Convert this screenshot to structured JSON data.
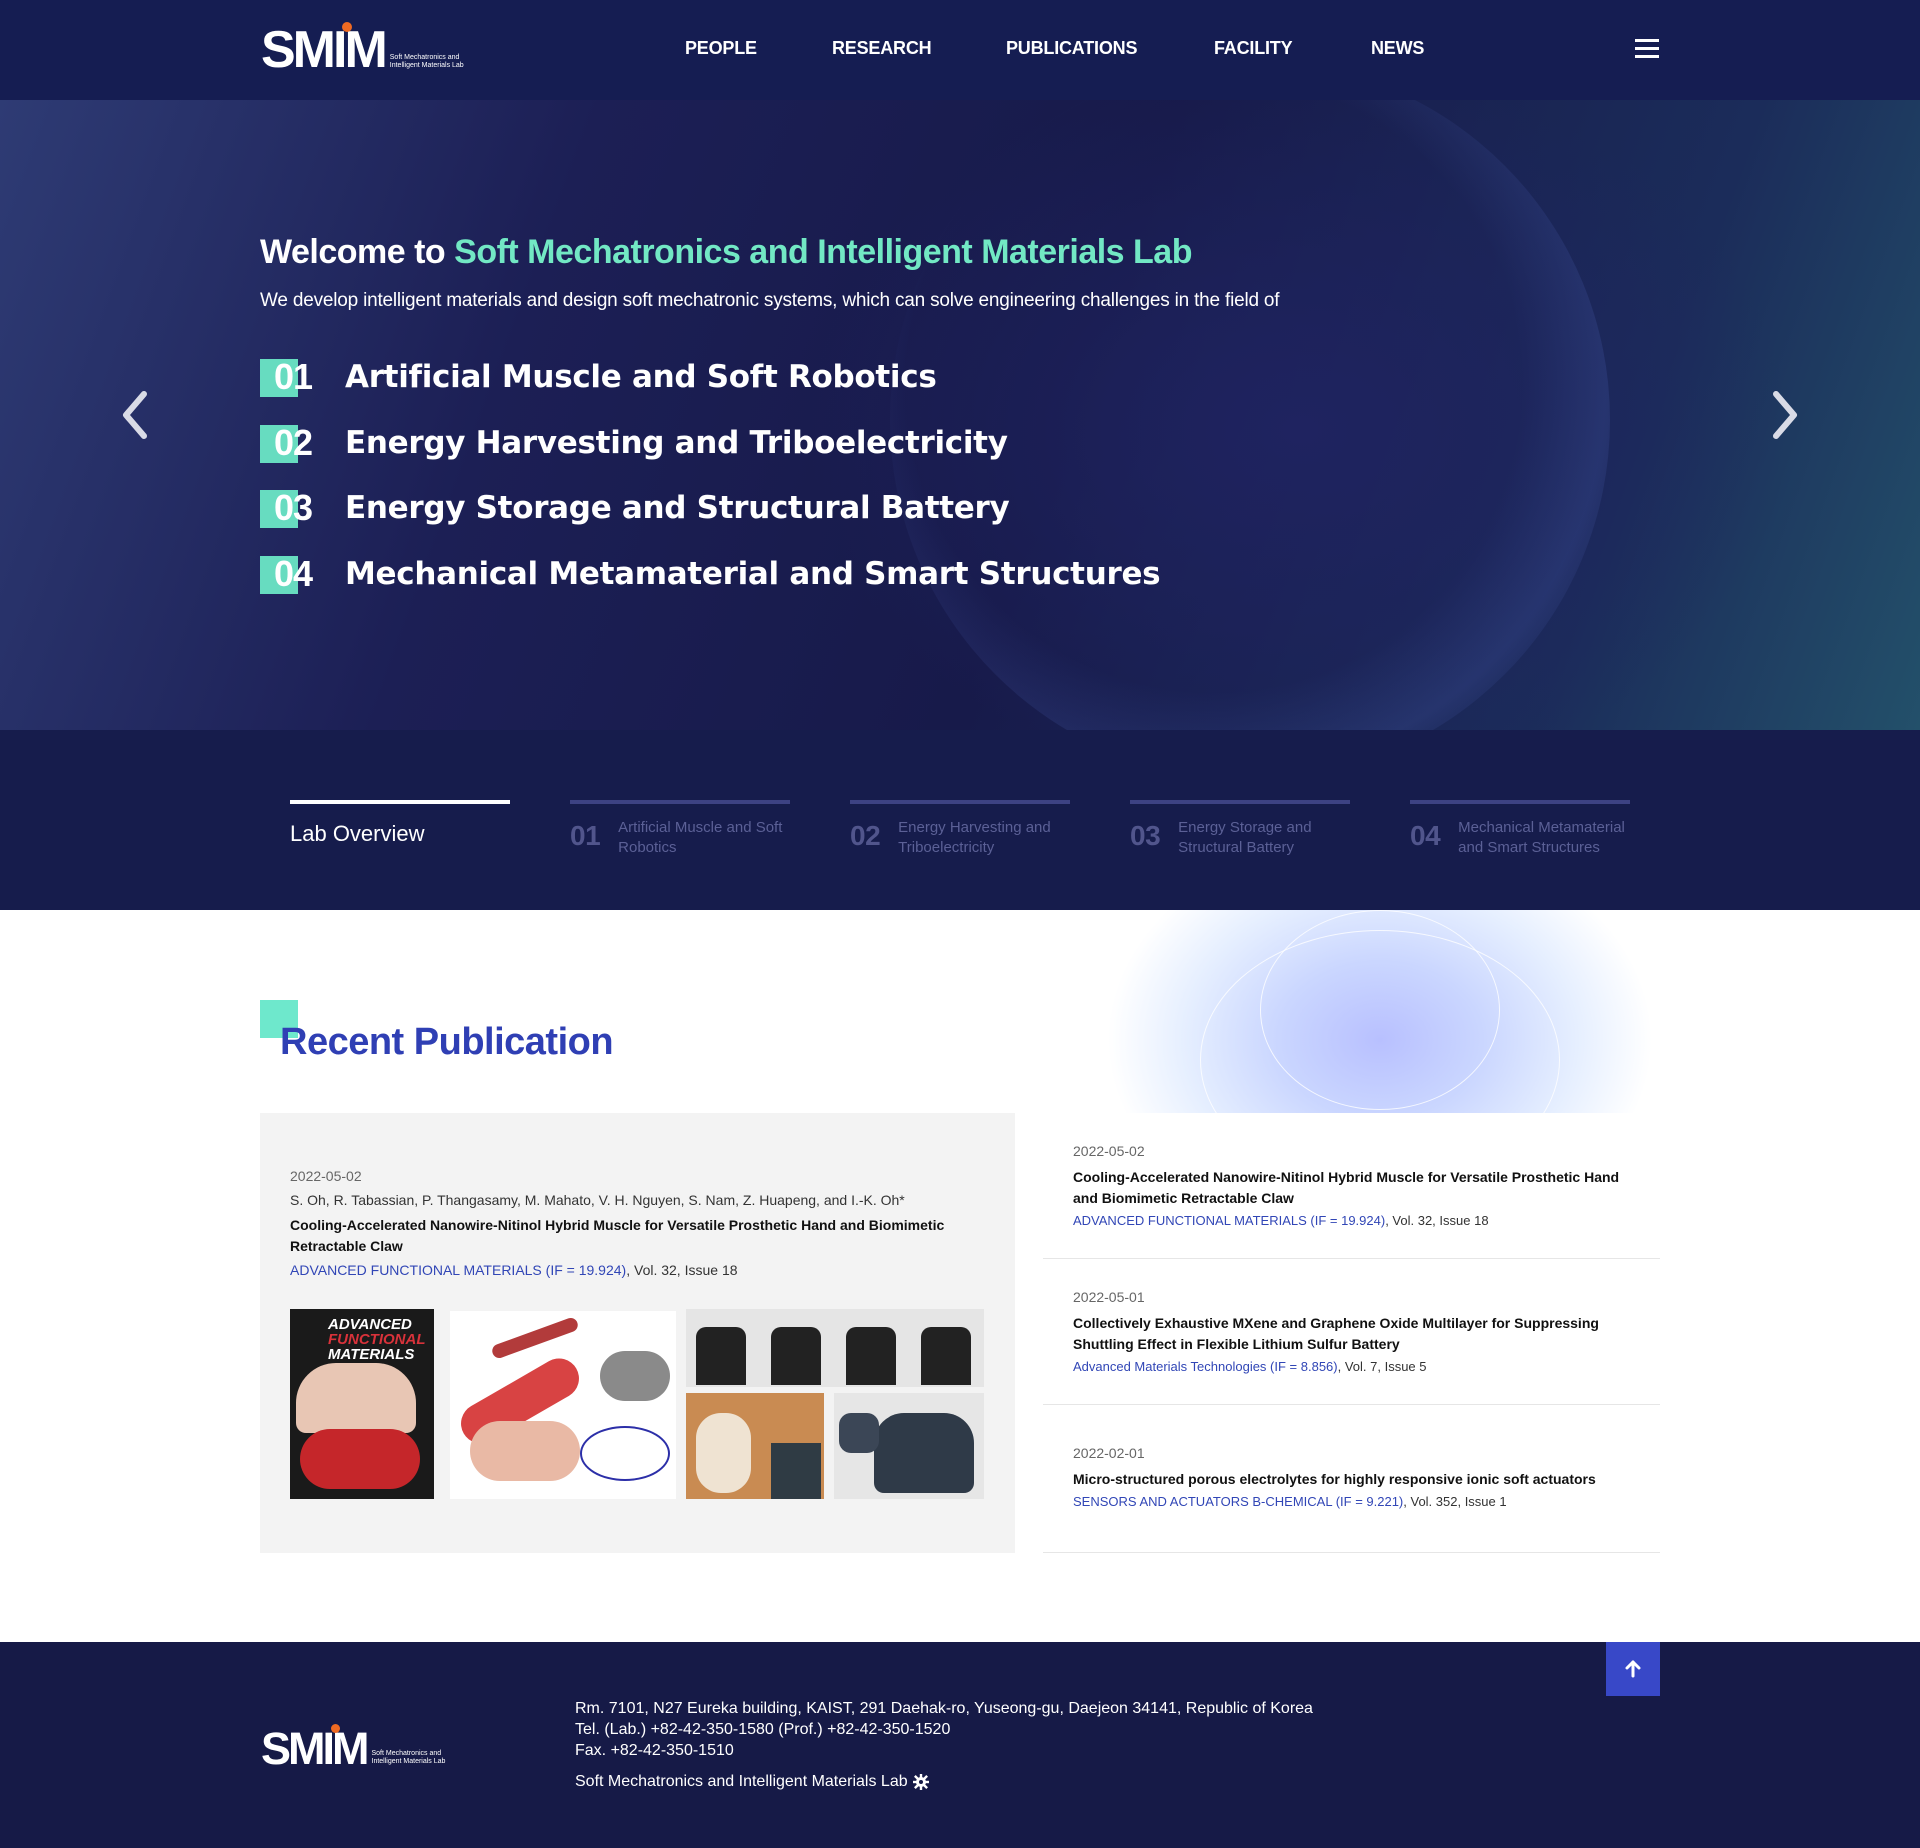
{
  "header": {
    "logo_text": "SMIM",
    "logo_sub": "Soft Mechatronics and Intelligent Materials Lab",
    "nav": [
      "PEOPLE",
      "RESEARCH",
      "PUBLICATIONS",
      "FACILITY",
      "NEWS"
    ],
    "menu_icon": "hamburger-icon"
  },
  "hero": {
    "title_prefix": "Welcome to ",
    "title_accent": "Soft Mechatronics and Intelligent Materials Lab",
    "subtitle": "We develop intelligent materials and design soft mechatronic systems, which can solve engineering challenges in the field of",
    "topics": [
      {
        "num": "01",
        "label": "Artificial Muscle and Soft Robotics"
      },
      {
        "num": "02",
        "label": "Energy Harvesting and Triboelectricity"
      },
      {
        "num": "03",
        "label": "Energy Storage and Structural Battery"
      },
      {
        "num": "04",
        "label": "Mechanical Metamaterial and Smart Structures"
      }
    ],
    "prev_icon": "chevron-left-icon",
    "next_icon": "chevron-right-icon",
    "accent_color": "#72e8c4"
  },
  "tabs": [
    {
      "num": "",
      "label": "Lab Overview"
    },
    {
      "num": "01",
      "label": "Artificial Muscle and Soft Robotics"
    },
    {
      "num": "02",
      "label": "Energy Harvesting and Triboelectricity"
    },
    {
      "num": "03",
      "label": "Energy Storage and Structural Battery"
    },
    {
      "num": "04",
      "label": "Mechanical Metamaterial and Smart Structures"
    }
  ],
  "publications": {
    "heading": "Recent Publication",
    "featured": {
      "date": "2022-05-02",
      "authors": "S. Oh, R. Tabassian, P. Thangasamy, M. Mahato, V. H. Nguyen, S. Nam, Z. Huapeng, and I.-K. Oh*",
      "title": "Cooling-Accelerated Nanowire-Nitinol Hybrid Muscle for Versatile Prosthetic Hand and Biomimetic Retractable Claw",
      "journal": "ADVANCED FUNCTIONAL MATERIALS (IF = 19.924)",
      "volume": ", Vol. 32, Issue 18",
      "cover_text_1": "ADVANCED",
      "cover_text_2": "FUNCTIONAL",
      "cover_text_3": "MATERIALS"
    },
    "items": [
      {
        "date": "2022-05-02",
        "title": "Cooling-Accelerated Nanowire-Nitinol Hybrid Muscle for Versatile Prosthetic Hand and Biomimetic Retractable Claw",
        "journal": "ADVANCED FUNCTIONAL MATERIALS (IF = 19.924)",
        "volume": ", Vol. 32, Issue 18"
      },
      {
        "date": "2022-05-01",
        "title": "Collectively Exhaustive MXene and Graphene Oxide Multilayer for Suppressing Shuttling Effect in Flexible Lithium Sulfur Battery",
        "journal": "Advanced Materials Technologies (IF = 8.856)",
        "volume": ", Vol. 7, Issue 5"
      },
      {
        "date": "2022-02-01",
        "title": "Micro-structured porous electrolytes for highly responsive ionic soft actuators",
        "journal": "SENSORS AND ACTUATORS B-CHEMICAL (IF = 9.221)",
        "volume": ", Vol. 352, Issue 1"
      }
    ]
  },
  "footer": {
    "address": "Rm. 7101, N27 Eureka building, KAIST, 291 Daehak-ro, Yuseong-gu, Daejeon 34141, Republic of Korea",
    "tel": "Tel. (Lab.) +82-42-350-1580 (Prof.) +82-42-350-1520",
    "fax": "Fax. +82-42-350-1510",
    "lab_name": "Soft Mechatronics and Intelligent Materials Lab",
    "settings_icon": "gear-icon",
    "top_icon": "arrow-up-icon"
  }
}
